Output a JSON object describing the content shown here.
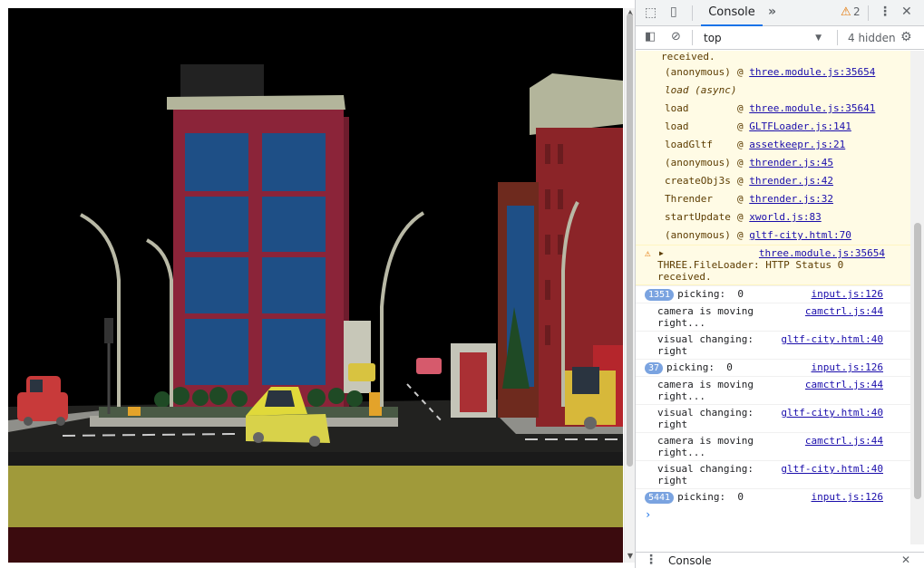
{
  "devtools": {
    "tab_label": "Console",
    "warning_count": "2",
    "context": "top",
    "hidden": "4 hidden",
    "drawer_tab": "Console"
  },
  "console": {
    "first_line": "received.",
    "trace": [
      {
        "fn": "(anonymous)",
        "src": "three.module.js:35654"
      },
      {
        "fn": "load (async)",
        "src": ""
      },
      {
        "fn": "load",
        "src": "three.module.js:35641"
      },
      {
        "fn": "load",
        "src": "GLTFLoader.js:141"
      },
      {
        "fn": "loadGltf",
        "src": "assetkeepr.js:21"
      },
      {
        "fn": "(anonymous)",
        "src": "thrender.js:45"
      },
      {
        "fn": "createObj3s",
        "src": "thrender.js:42"
      },
      {
        "fn": "Thrender",
        "src": "thrender.js:32"
      },
      {
        "fn": "startUpdate",
        "src": "xworld.js:83"
      },
      {
        "fn": "(anonymous)",
        "src": "gltf-city.html:70"
      }
    ],
    "warning": {
      "src": "three.module.js:35654",
      "text": "THREE.FileLoader: HTTP Status 0 received."
    },
    "messages": [
      {
        "badge": "1351",
        "text": "picking:  0",
        "src": "input.js:126"
      },
      {
        "badge": "",
        "text": "camera is moving right...",
        "src": "camctrl.js:44"
      },
      {
        "badge": "",
        "text": "visual changing: right",
        "src": "gltf-city.html:40"
      },
      {
        "badge": "37",
        "text": "picking:  0",
        "src": "input.js:126"
      },
      {
        "badge": "",
        "text": "camera is moving right...",
        "src": "camctrl.js:44"
      },
      {
        "badge": "",
        "text": "visual changing: right",
        "src": "gltf-city.html:40"
      },
      {
        "badge": "",
        "text": "camera is moving right...",
        "src": "camctrl.js:44"
      },
      {
        "badge": "",
        "text": "visual changing: right",
        "src": "gltf-city.html:40"
      },
      {
        "badge": "5441",
        "text": "picking:  0",
        "src": "input.js:126"
      }
    ],
    "prompt": "›"
  },
  "colors": {
    "accent": "#1a73e8",
    "warn_bg": "#fffbe5",
    "badge": "#7aa3e0",
    "link": "#1a0dab"
  },
  "icons": {
    "inspect": "inspect-icon",
    "device": "device-toggle-icon",
    "more_tabs": "more-tabs-icon",
    "warning": "warning-icon",
    "kebab": "kebab-menu-icon",
    "close": "close-icon",
    "sidebar": "sidebar-toggle-icon",
    "clear": "clear-console-icon",
    "settings": "gear-icon"
  }
}
